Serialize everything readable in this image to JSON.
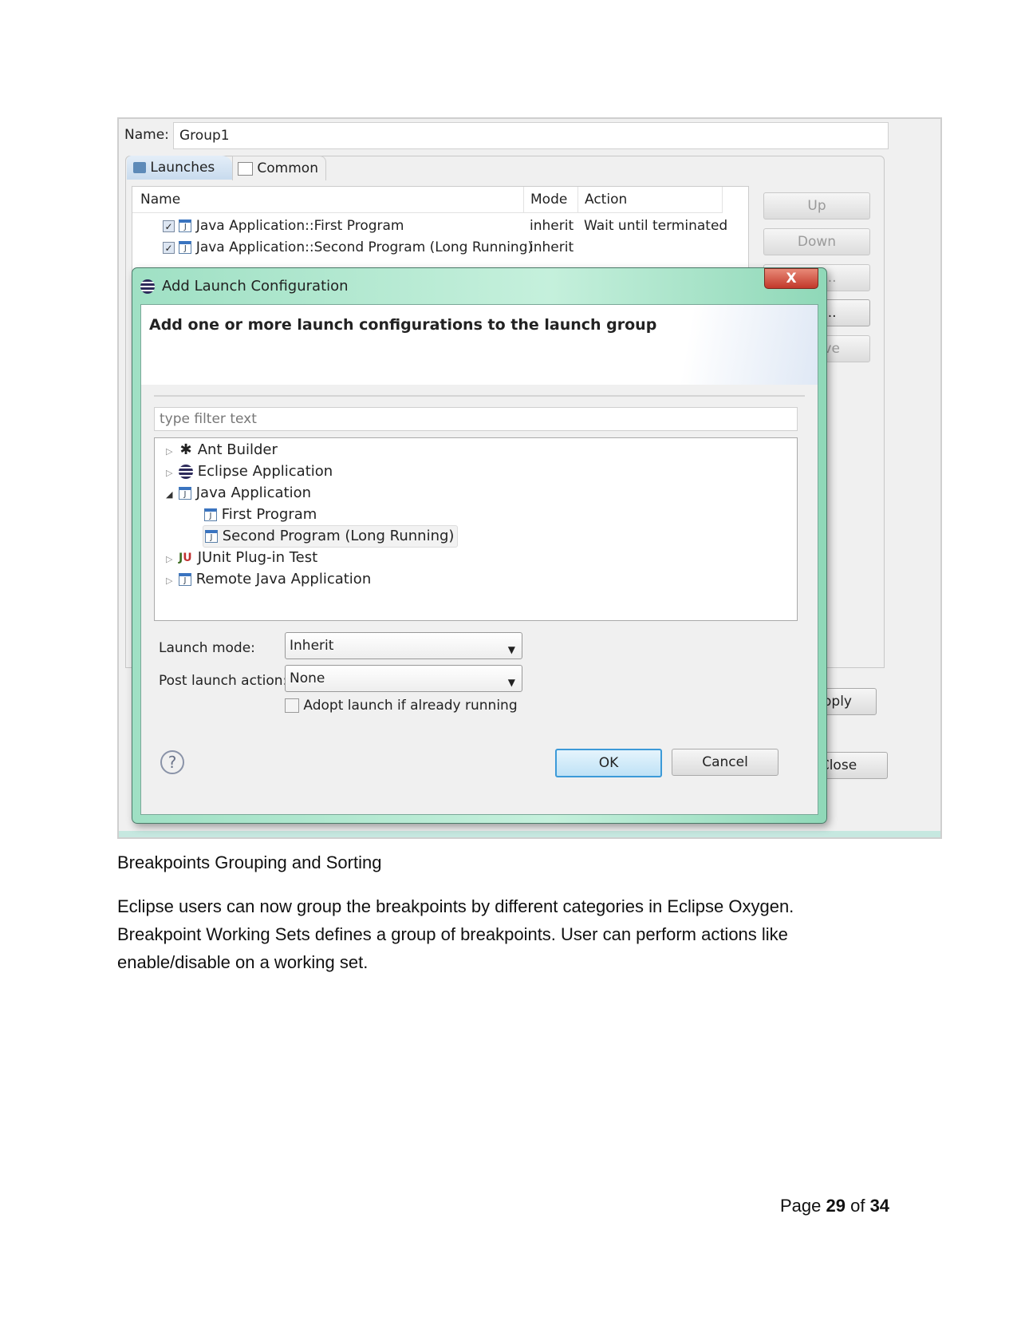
{
  "launch_group": {
    "name_label": "Name:",
    "name_value": "Group1",
    "tabs": [
      {
        "label": "Launches",
        "icon": "launch-icon"
      },
      {
        "label": "Common",
        "icon": "common-tab-icon"
      }
    ],
    "columns": [
      "Name",
      "Mode",
      "Action"
    ],
    "rows": [
      {
        "name": "Java Application::First Program",
        "mode": "inherit",
        "action": "Wait until terminated",
        "checked": true
      },
      {
        "name": "Java Application::Second Program (Long Running)",
        "mode": "inherit",
        "action": "",
        "checked": true
      }
    ],
    "side_buttons": {
      "up": "Up",
      "down": "Down",
      "edit": "Edit...",
      "add": "Add...",
      "remove": "emove"
    },
    "apply": "Apply",
    "close": "Close"
  },
  "dialog": {
    "title": "Add Launch Configuration",
    "close_glyph": "X",
    "heading": "Add one or more launch configurations to the launch group",
    "filter_placeholder": "type filter text",
    "tree": [
      {
        "label": "Ant Builder",
        "icon": "ant-icon",
        "expander": "▷",
        "level": 0
      },
      {
        "label": "Eclipse Application",
        "icon": "eclipse-icon",
        "expander": "▷",
        "level": 0
      },
      {
        "label": "Java Application",
        "icon": "java-app-icon",
        "expander": "◢",
        "level": 0
      },
      {
        "label": "First Program",
        "icon": "java-app-icon",
        "expander": "",
        "level": 1
      },
      {
        "label": "Second Program (Long Running)",
        "icon": "java-app-icon",
        "expander": "",
        "level": 1,
        "selected": true
      },
      {
        "label": "JUnit Plug-in Test",
        "icon": "junit-icon",
        "expander": "▷",
        "level": 0
      },
      {
        "label": "Remote Java Application",
        "icon": "remote-java-icon",
        "expander": "▷",
        "level": 0
      }
    ],
    "launch_mode_label": "Launch mode:",
    "launch_mode_value": "Inherit",
    "post_action_label": "Post launch action:",
    "post_action_value": "None",
    "adopt_label": "Adopt launch if already running",
    "adopt_checked": false,
    "help_glyph": "?",
    "ok": "OK",
    "cancel": "Cancel"
  },
  "document": {
    "heading": "Breakpoints Grouping and Sorting",
    "paragraph_lines": [
      "Eclipse users can now group the breakpoints by different categories in Eclipse Oxygen.",
      "Breakpoint Working Sets defines a group of breakpoints. User can perform actions like",
      "enable/disable on a working set."
    ],
    "footer": {
      "prefix": "Page ",
      "current": "29",
      "middle": " of ",
      "total": "34"
    }
  }
}
